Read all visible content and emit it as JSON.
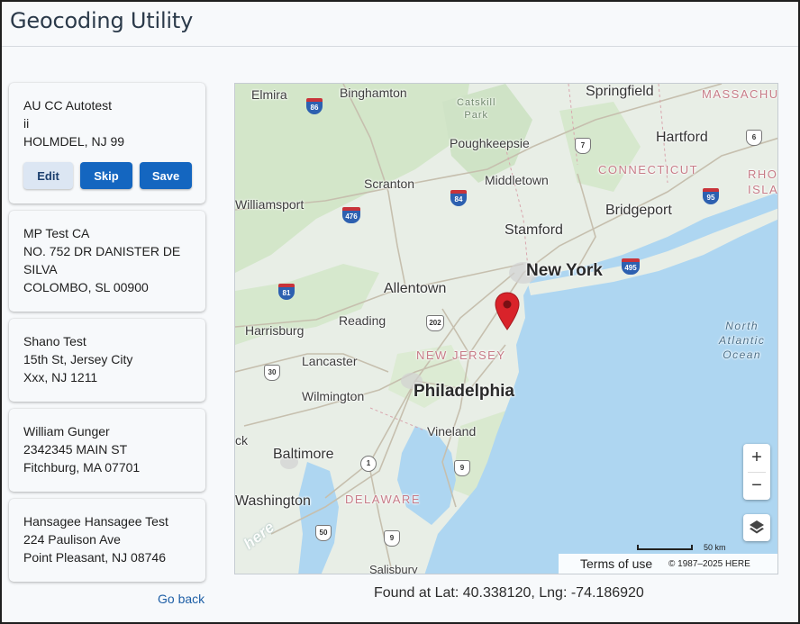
{
  "app": {
    "title": "Geocoding Utility"
  },
  "records": [
    {
      "lines": [
        "AU CC Autotest",
        "ii",
        "HOLMDEL, NJ 99"
      ],
      "actions": {
        "edit": "Edit",
        "skip": "Skip",
        "save": "Save"
      }
    },
    {
      "lines": [
        "MP Test CA",
        "NO. 752 DR DANISTER DE",
        "SILVA",
        "COLOMBO, SL 00900"
      ]
    },
    {
      "lines": [
        "Shano Test",
        "15th St, Jersey City",
        "Xxx, NJ 1211"
      ]
    },
    {
      "lines": [
        "William Gunger",
        "2342345 MAIN ST",
        "Fitchburg, MA 07701"
      ]
    },
    {
      "lines": [
        "Hansagee Hansagee Test",
        "224 Paulison Ave",
        "Point Pleasant, NJ 08746"
      ]
    }
  ],
  "nav": {
    "go_back": "Go back"
  },
  "map": {
    "places": {
      "elmira": "Elmira",
      "binghamton": "Binghamton",
      "springfield": "Springfield",
      "massachusetts": "MASSACHU",
      "catskill": "Catskill",
      "park": "Park",
      "poughkeepsie": "Poughkeepsie",
      "hartford": "Hartford",
      "connecticut": "CONNECTICUT",
      "rhode1": "RHO",
      "rhode2": "ISLA",
      "scranton": "Scranton",
      "middletown": "Middletown",
      "williamsport": "Williamsport",
      "bridgeport": "Bridgeport",
      "stamford": "Stamford",
      "new_york": "New York",
      "allentown": "Allentown",
      "harrisburg": "Harrisburg",
      "reading": "Reading",
      "new_jersey": "NEW JERSEY",
      "north": "North",
      "atlantic": "Atlantic",
      "ocean": "Ocean",
      "lancaster": "Lancaster",
      "philadelphia": "Philadelphia",
      "wilmington": "Wilmington",
      "vineland": "Vineland",
      "ck": "ck",
      "baltimore": "Baltimore",
      "washington": "Washington",
      "delaware": "DELAWARE",
      "salisbury": "Salisbury"
    },
    "shields": {
      "i86": "86",
      "r7": "7",
      "r6": "6",
      "i84": "84",
      "i476": "476",
      "i95": "95",
      "i495": "495",
      "i81": "81",
      "us202": "202",
      "r30": "30",
      "r1": "1",
      "r9": "9",
      "r50": "50",
      "r9b": "9"
    },
    "zoom_in": "+",
    "zoom_out": "−",
    "scale_label": "50 km",
    "terms": "Terms of use",
    "copyright": "© 1987–2025 HERE",
    "logo": "here",
    "colors": {
      "water": "#aed6f1",
      "land": "#e8eee6",
      "forest": "#cfe3c6",
      "road": "#c9c2b2",
      "pin": "#d9232a"
    }
  },
  "status": {
    "found": "Found at Lat: 40.338120, Lng: -74.186920"
  }
}
